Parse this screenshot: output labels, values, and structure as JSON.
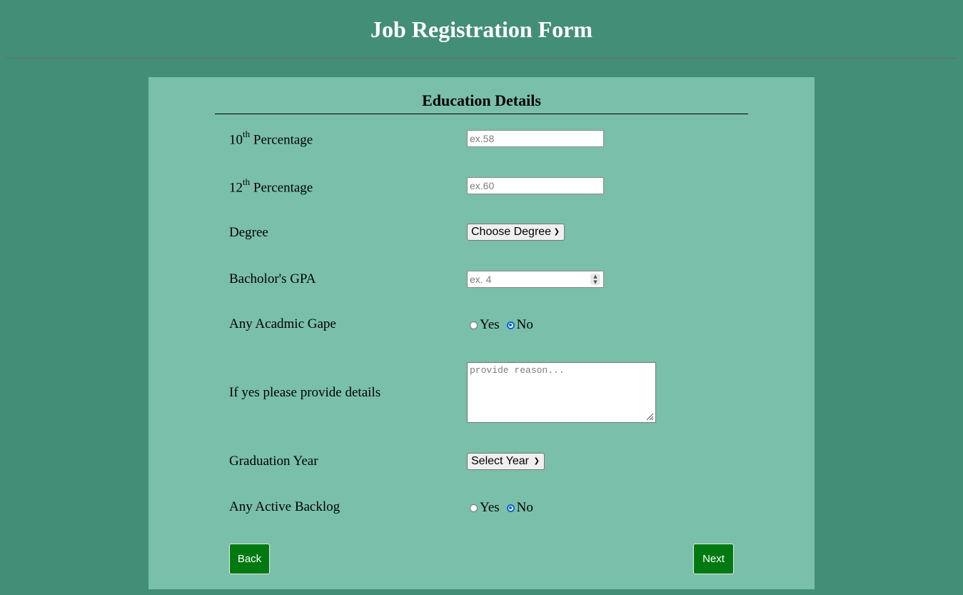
{
  "header": {
    "title": "Job Registration Form"
  },
  "section": {
    "title": "Education Details"
  },
  "fields": {
    "tenth": {
      "label_num": "10",
      "label_sup": "th",
      "label_text": " Percentage",
      "placeholder": "ex.58",
      "value": ""
    },
    "twelfth": {
      "label_num": "12",
      "label_sup": "th",
      "label_text": " Percentage",
      "placeholder": "ex.60",
      "value": ""
    },
    "degree": {
      "label": "Degree",
      "selected": "Choose Degree"
    },
    "gpa": {
      "label": "Bacholor's GPA",
      "placeholder": "ex. 4",
      "value": ""
    },
    "gap": {
      "label": "Any Acadmic Gape",
      "options": [
        "Yes",
        "No"
      ],
      "selected": "No"
    },
    "details": {
      "label": "If yes please provide details",
      "placeholder": "provide reason...",
      "value": ""
    },
    "grad_year": {
      "label": "Graduation Year",
      "selected": "Select Year"
    },
    "backlog": {
      "label": "Any Active Backlog",
      "options": [
        "Yes",
        "No"
      ],
      "selected": "No"
    }
  },
  "buttons": {
    "back": "Back",
    "next": "Next"
  },
  "icons": {
    "chevron": "chevron-down-icon",
    "spinner": "spinner-icon",
    "resize": "resize-handle-icon"
  },
  "colors": {
    "background": "#438e77",
    "panel": "#7abfaa",
    "button": "#007a10",
    "radio_checked": "#0b63ce"
  }
}
